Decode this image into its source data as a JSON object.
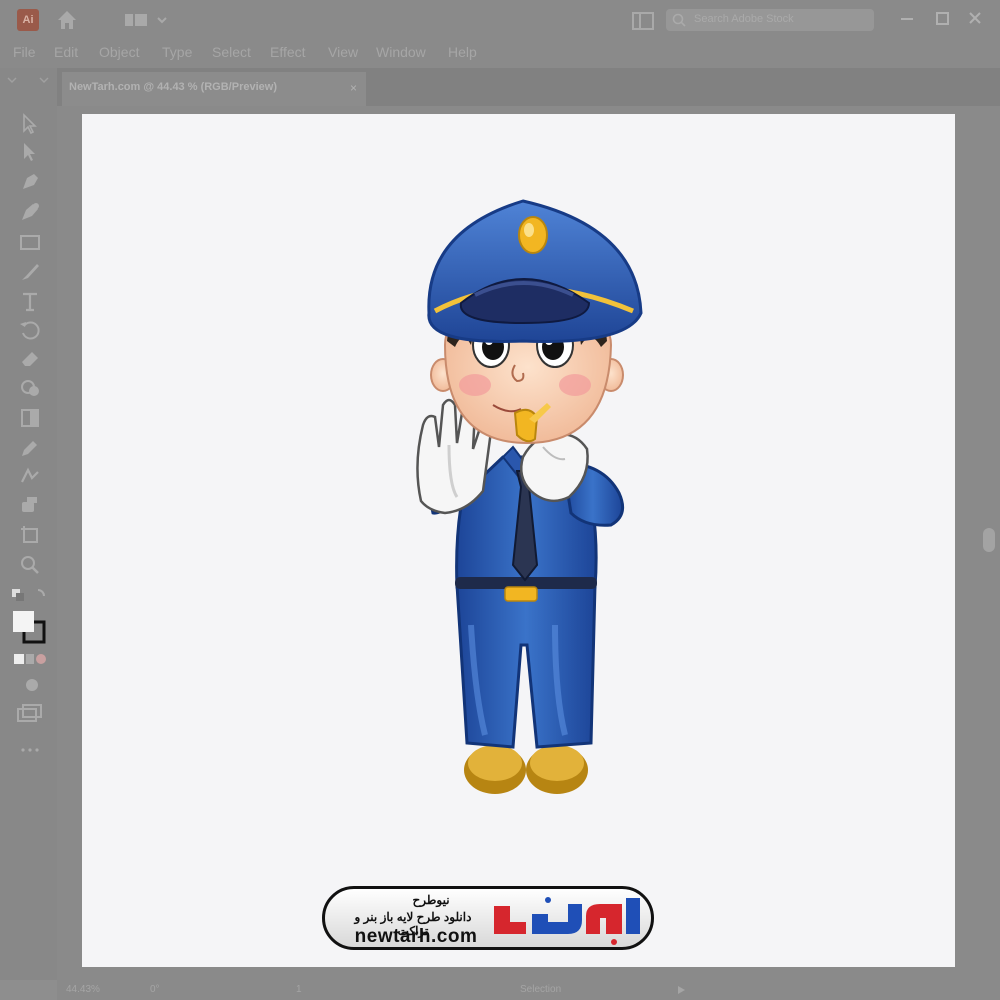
{
  "app": {
    "logo": "Ai"
  },
  "search": {
    "placeholder": "Search Adobe Stock"
  },
  "menu": [
    "File",
    "Edit",
    "Object",
    "Type",
    "Select",
    "Effect",
    "View",
    "Window",
    "Help"
  ],
  "document_tab": {
    "title": "NewTarh.com @ 44.43 % (RGB/Preview)",
    "close": "×"
  },
  "tools": [
    "selection-tool-icon",
    "direct-selection-tool-icon",
    "pen-tool-icon",
    "curvature-tool-icon",
    "rectangle-tool-icon",
    "paintbrush-tool-icon",
    "type-tool-icon",
    "rotate-tool-icon",
    "eraser-tool-icon",
    "shape-builder-tool-icon",
    "gradient-tool-icon",
    "eyedropper-tool-icon",
    "blend-tool-icon",
    "symbol-sprayer-tool-icon",
    "artboard-tool-icon",
    "zoom-tool-icon"
  ],
  "status": {
    "zoom": "44.43%",
    "rotation": "0°",
    "artboard": "1",
    "mode": "Selection"
  },
  "colors": {
    "uniform": "#2f5fb0",
    "cap": "#2a4f9c",
    "badge": "#f2b622",
    "skin": "#f4c4a8",
    "shoes": "#d9a629",
    "logo_red": "#d6262d",
    "logo_blue": "#1f4fb7"
  },
  "watermark": {
    "line1": "نیوطرح",
    "line2": "دانلود طرح لایه باز بنر و تراکت",
    "line3": "newtarh.com",
    "logo_text": "نیوطرح"
  }
}
